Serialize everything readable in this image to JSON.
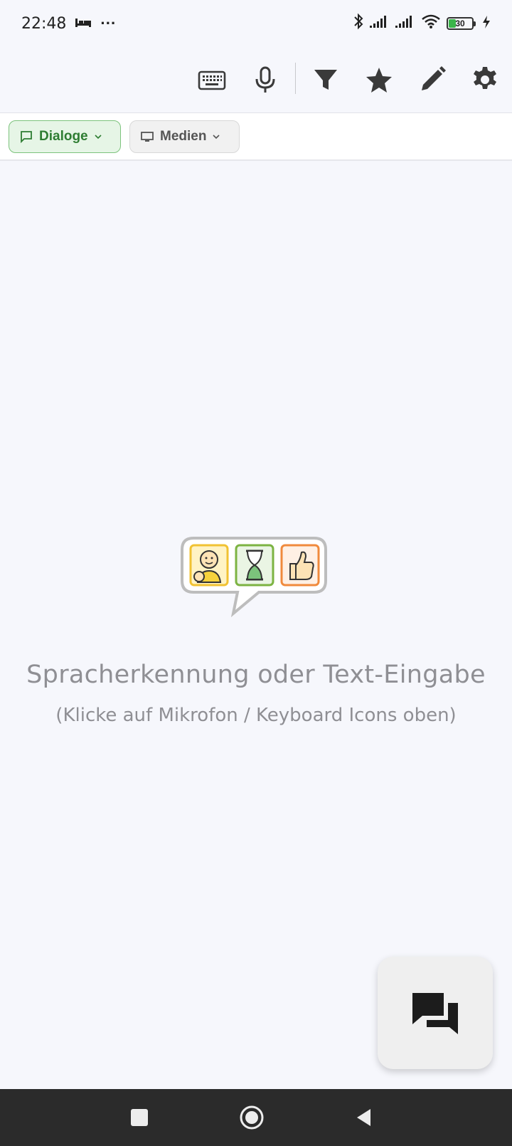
{
  "status_bar": {
    "time": "22:48",
    "dots": "···",
    "battery_level": "30",
    "icons": [
      "sleep-icon",
      "bluetooth-icon",
      "signal-icon",
      "signal-icon",
      "wifi-icon",
      "battery-icon",
      "charging-icon"
    ]
  },
  "toolbar": {
    "icons": [
      "keyboard-icon",
      "microphone-icon",
      "filter-icon",
      "star-icon",
      "pencil-icon",
      "gear-icon"
    ]
  },
  "filters": {
    "dialoge_label": "Dialoge",
    "medien_label": "Medien"
  },
  "empty_state": {
    "title": "Spracherkennung oder Text-Eingabe",
    "hint": "(Klicke auf Mikrofon / Keyboard Icons oben)"
  },
  "fab": {
    "icon": "chat-bubbles-icon"
  },
  "nav_bar": {
    "icons": [
      "recents-square-icon",
      "home-circle-icon",
      "back-triangle-icon"
    ]
  },
  "colors": {
    "background": "#f6f7fc",
    "chip_active_bg": "#e6f5e6",
    "chip_active_text": "#2e7d32",
    "hint_text": "#8f8f94",
    "nav_bar": "#2b2b2b"
  }
}
